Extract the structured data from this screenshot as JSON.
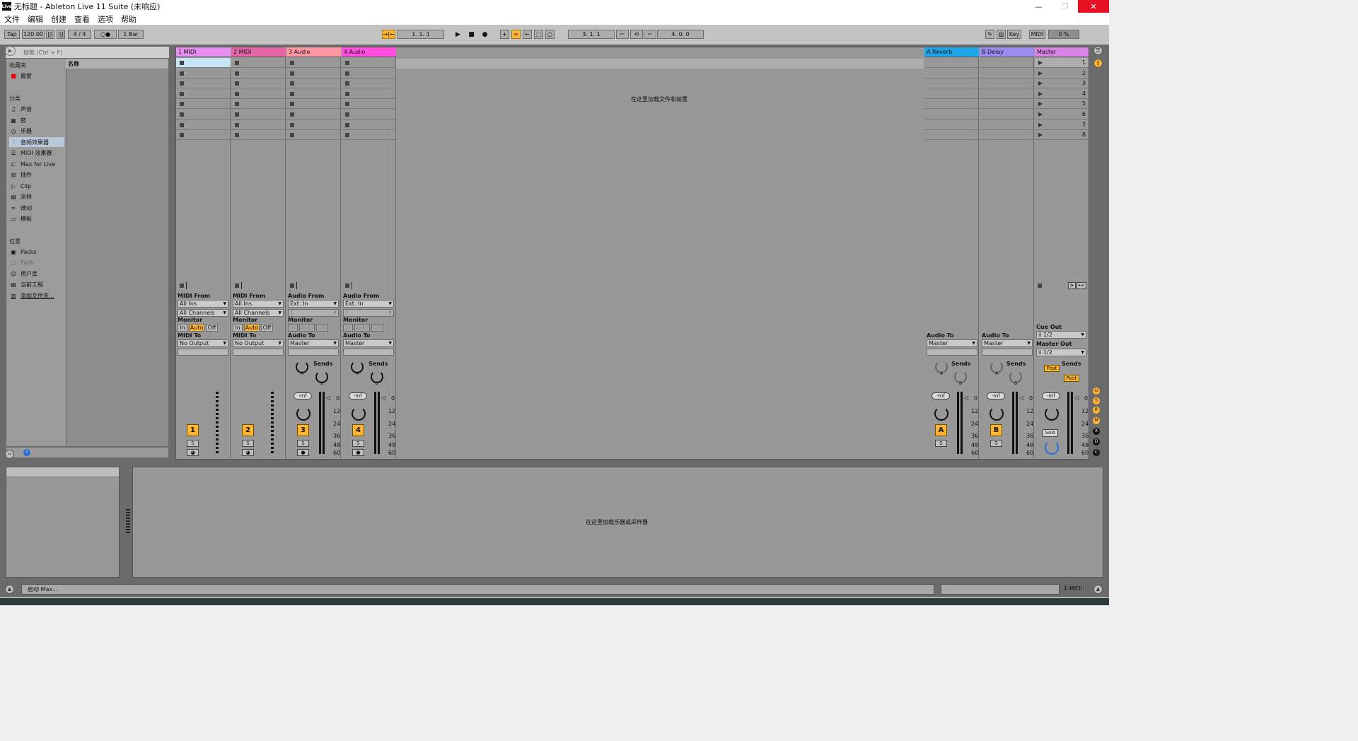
{
  "window": {
    "title": "无标题 - Ableton Live 11 Suite (未响应)",
    "app_icon": "Live"
  },
  "menu": [
    "文件",
    "编辑",
    "创建",
    "查看",
    "选项",
    "帮助"
  ],
  "control": {
    "tap": "Tap",
    "tempo": "120.00",
    "signature": "4 / 4",
    "metronome": "○●",
    "quantize": "1 Bar",
    "arrangement_position": "1.   1.   1",
    "loop_start": "3.   1.   1",
    "loop_length": "4.   0.   0",
    "key": "Key",
    "midi": "MIDI",
    "cpu": "0 %"
  },
  "browser": {
    "search_placeholder": "搜索 (Ctrl + F)",
    "column_header": "名称",
    "favorites_title": "收藏夹",
    "favorites": [
      "最爱"
    ],
    "categories_title": "分类",
    "categories": [
      {
        "label": "声音",
        "icon": "music-note-icon"
      },
      {
        "label": "鼓",
        "icon": "drum-grid-icon"
      },
      {
        "label": "乐器",
        "icon": "instrument-icon"
      },
      {
        "label": "音频效果器",
        "icon": "audio-fx-icon"
      },
      {
        "label": "MIDI 效果器",
        "icon": "midi-fx-icon"
      },
      {
        "label": "Max for Live",
        "icon": "max-icon"
      },
      {
        "label": "插件",
        "icon": "plugin-icon"
      },
      {
        "label": "Clip",
        "icon": "clip-icon"
      },
      {
        "label": "采样",
        "icon": "sample-icon"
      },
      {
        "label": "律动",
        "icon": "groove-icon"
      },
      {
        "label": "模板",
        "icon": "template-icon"
      }
    ],
    "places_title": "位置",
    "places": [
      {
        "label": "Packs",
        "icon": "packs-icon"
      },
      {
        "label": "Push",
        "icon": "push-icon"
      },
      {
        "label": "用户库",
        "icon": "user-library-icon"
      },
      {
        "label": "当前工程",
        "icon": "project-icon"
      },
      {
        "label": "添加文件夹...",
        "icon": "add-folder-icon"
      }
    ]
  },
  "tracks": [
    {
      "name": "1 MIDI",
      "color": "#e78ff0",
      "type": "midi",
      "from_label": "MIDI From",
      "from": "All Ins",
      "channel": "All Channels",
      "to_label": "MIDI To",
      "to": "No Output",
      "number": "1"
    },
    {
      "name": "2 MIDI",
      "color": "#e566a6",
      "type": "midi",
      "from_label": "MIDI From",
      "from": "All Ins",
      "channel": "All Channels",
      "to_label": "MIDI To",
      "to": "No Output",
      "number": "2"
    },
    {
      "name": "3 Audio",
      "color": "#ff99a6",
      "type": "audio",
      "from_label": "Audio From",
      "from": "Ext. In",
      "channel": "1",
      "to_label": "Audio To",
      "to": "Master",
      "number": "3"
    },
    {
      "name": "4 Audio",
      "color": "#ff4ee0",
      "type": "audio",
      "from_label": "Audio From",
      "from": "Ext. In",
      "channel": "2",
      "to_label": "Audio To",
      "to": "Master",
      "number": "4"
    }
  ],
  "returns": [
    {
      "name": "A Reverb",
      "color": "#1fa6e8",
      "to_label": "Audio To",
      "to": "Master",
      "letter": "A"
    },
    {
      "name": "B Delay",
      "color": "#9a8cf0",
      "to_label": "Audio To",
      "to": "Master",
      "letter": "B"
    }
  ],
  "master": {
    "name": "Master",
    "color": "#d985e8",
    "cue_label": "Cue Out",
    "cue": "ii 1/2",
    "out_label": "Master Out",
    "out": "ii 1/2",
    "solo": "Solo",
    "post": "Post"
  },
  "scenes": [
    "1",
    "2",
    "3",
    "4",
    "5",
    "6",
    "7",
    "8"
  ],
  "mixer": {
    "monitor_label": "Monitor",
    "mon_in": "In",
    "mon_auto": "Auto",
    "mon_off": "Off",
    "sends_label": "Sends",
    "vol": "-Inf",
    "solo_short": "S",
    "send_a": "A",
    "send_b": "B",
    "scale": [
      "0",
      "12",
      "24",
      "36",
      "48",
      "60"
    ]
  },
  "hints": {
    "drop_files": "在这里加载文件和装置",
    "drop_instrument": "在这里加载乐器或采样器"
  },
  "status": {
    "message": "启动 Max...",
    "track": "1-MIDI"
  }
}
